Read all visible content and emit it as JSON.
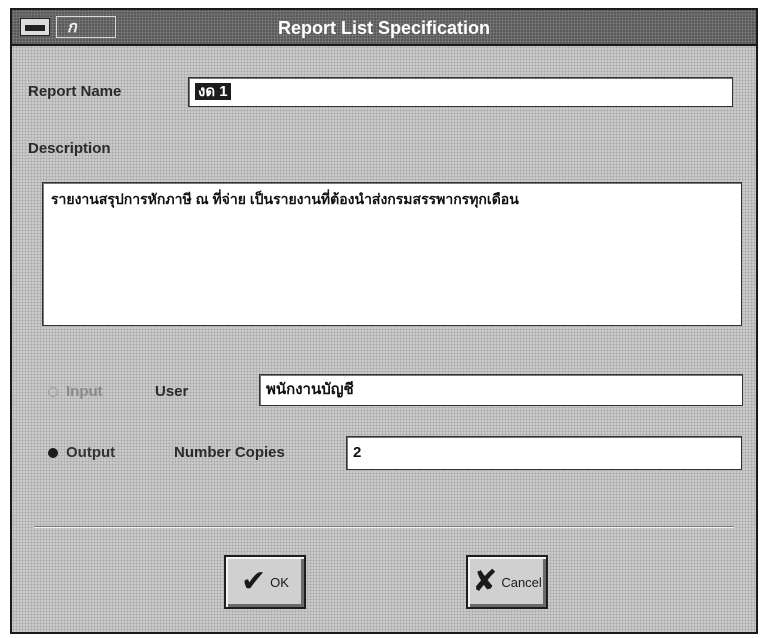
{
  "window": {
    "title": "Report List Specification",
    "system_menu_glyph": "▬",
    "title_icon_glyph": "ก"
  },
  "form": {
    "report_name_label": "Report Name",
    "report_name_value": "งด 1",
    "description_label": "Description",
    "description_value": "รายงานสรุปการหักภาษี ณ ที่จ่าย เป็นรายงานที่ต้องนำส่งกรมสรรพากรทุกเดือน",
    "input_option_label": "Input",
    "user_label": "User",
    "user_value": "พนักงานบัญชี",
    "output_option_label": "Output",
    "number_copies_label": "Number Copies",
    "number_copies_value": "2",
    "selected_option": "Output"
  },
  "buttons": {
    "ok_label": "OK",
    "ok_icon": "check-icon",
    "ok_glyph": "✔",
    "cancel_label": "Cancel",
    "cancel_icon": "cross-icon",
    "cancel_glyph": "✘"
  }
}
